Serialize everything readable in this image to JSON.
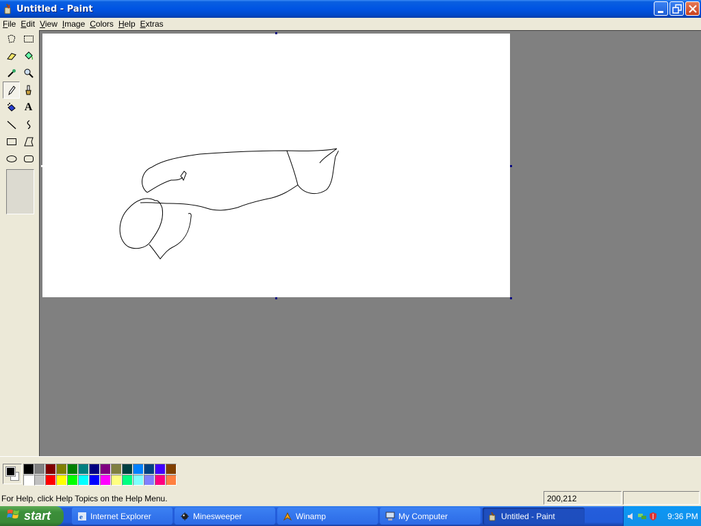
{
  "window": {
    "title": "Untitled - Paint"
  },
  "menu": {
    "items": [
      "File",
      "Edit",
      "View",
      "Image",
      "Colors",
      "Help",
      "Extras"
    ]
  },
  "tools": [
    {
      "id": "free-select",
      "icon": "free-form-select-icon"
    },
    {
      "id": "select",
      "icon": "rectangle-select-icon"
    },
    {
      "id": "eraser",
      "icon": "eraser-icon"
    },
    {
      "id": "fill",
      "icon": "fill-bucket-icon"
    },
    {
      "id": "pick-color",
      "icon": "eyedropper-icon"
    },
    {
      "id": "magnifier",
      "icon": "magnifier-icon"
    },
    {
      "id": "pencil",
      "icon": "pencil-icon",
      "selected": true
    },
    {
      "id": "brush",
      "icon": "brush-icon"
    },
    {
      "id": "airbrush",
      "icon": "airbrush-icon"
    },
    {
      "id": "text",
      "icon": "text-icon",
      "label": "A"
    },
    {
      "id": "line",
      "icon": "line-icon"
    },
    {
      "id": "curve",
      "icon": "curve-icon"
    },
    {
      "id": "rectangle",
      "icon": "rectangle-icon"
    },
    {
      "id": "polygon",
      "icon": "polygon-icon"
    },
    {
      "id": "ellipse",
      "icon": "ellipse-icon"
    },
    {
      "id": "rounded-rectangle",
      "icon": "rounded-rectangle-icon"
    }
  ],
  "colors": {
    "foreground": "#000000",
    "background": "#ffffff",
    "palette_top": [
      "#000000",
      "#808080",
      "#800000",
      "#808000",
      "#008000",
      "#008080",
      "#000080",
      "#800080",
      "#808040",
      "#004040",
      "#0080ff",
      "#004080",
      "#4000ff",
      "#804000"
    ],
    "palette_bottom": [
      "#ffffff",
      "#c0c0c0",
      "#ff0000",
      "#ffff00",
      "#00ff00",
      "#00ffff",
      "#0000ff",
      "#ff00ff",
      "#ffff80",
      "#00ff80",
      "#80ffff",
      "#8080ff",
      "#ff0080",
      "#ff8040"
    ]
  },
  "status": {
    "help": "For Help, click Help Topics on the Help Menu.",
    "coords": "200,212",
    "size": ""
  },
  "taskbar": {
    "start_label": "start",
    "tasks": [
      {
        "label": "Internet Explorer",
        "icon": "internet-explorer-icon"
      },
      {
        "label": "Minesweeper",
        "icon": "minesweeper-icon"
      },
      {
        "label": "Winamp",
        "icon": "winamp-icon"
      },
      {
        "label": "My Computer",
        "icon": "my-computer-icon"
      },
      {
        "label": "Untitled - Paint",
        "icon": "paint-icon",
        "active": true
      }
    ],
    "clock": "9:36 PM"
  }
}
